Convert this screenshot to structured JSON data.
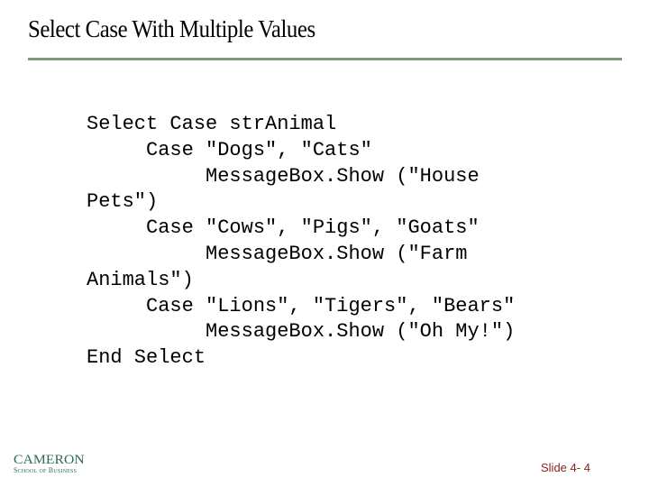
{
  "slide": {
    "title": "Select Case With Multiple Values",
    "code_lines": [
      "Select Case strAnimal",
      "     Case \"Dogs\", \"Cats\"",
      "          MessageBox.Show (\"House",
      "Pets\")",
      "     Case \"Cows\", \"Pigs\", \"Goats\"",
      "          MessageBox.Show (\"Farm",
      "Animals\")",
      "     Case \"Lions\", \"Tigers\", \"Bears\"",
      "          MessageBox.Show (\"Oh My!\")",
      "End Select"
    ],
    "slide_number": "Slide 4- 4"
  },
  "logo": {
    "name": "CAMERON",
    "subtitle": "School of Business"
  },
  "colors": {
    "title_rule": "#7f9a80",
    "logo": "#2e6b5e",
    "slide_number": "#8b1e1e"
  }
}
